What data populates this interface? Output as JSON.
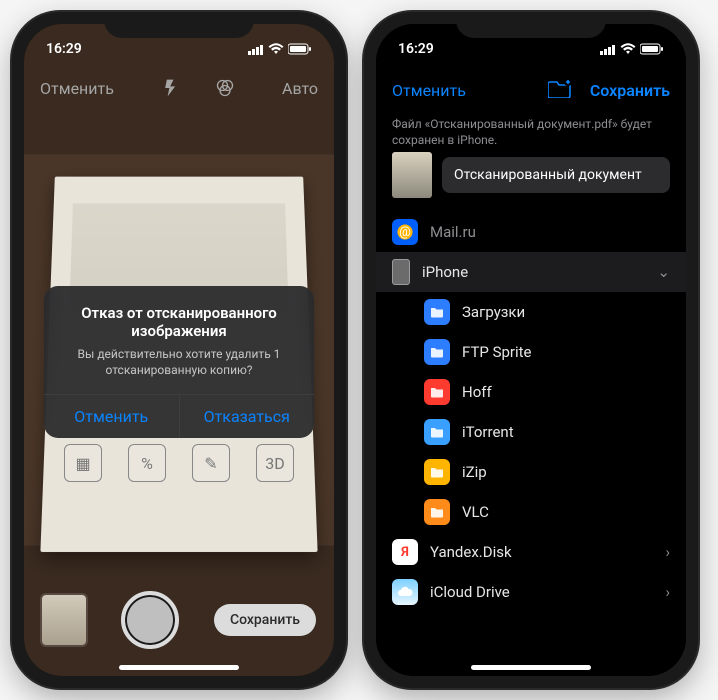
{
  "status": {
    "time": "16:29"
  },
  "phone1": {
    "toolbar": {
      "cancel": "Отменить",
      "auto": "Авто"
    },
    "dialog": {
      "title": "Отказ от отсканированного изображения",
      "message": "Вы действительно хотите удалить 1 отсканированную копию?",
      "cancel": "Отменить",
      "discard": "Отказаться"
    },
    "save_button": "Сохранить"
  },
  "phone2": {
    "nav": {
      "cancel": "Отменить",
      "save": "Сохранить"
    },
    "subtitle": "Файл «Отсканированный документ.pdf» будет сохранен в iPhone.",
    "filename": "Отсканированный документ",
    "locations": {
      "mailru": "Mail.ru",
      "iphone": "iPhone",
      "folders": [
        {
          "label": "Загрузки",
          "cls": "dl"
        },
        {
          "label": "FTP Sprite",
          "cls": "ftp"
        },
        {
          "label": "Hoff",
          "cls": "hoff"
        },
        {
          "label": "iTorrent",
          "cls": "itor"
        },
        {
          "label": "iZip",
          "cls": "izip"
        },
        {
          "label": "VLC",
          "cls": "vlc"
        }
      ],
      "yandex": "Yandex.Disk",
      "icloud": "iCloud Drive"
    }
  }
}
